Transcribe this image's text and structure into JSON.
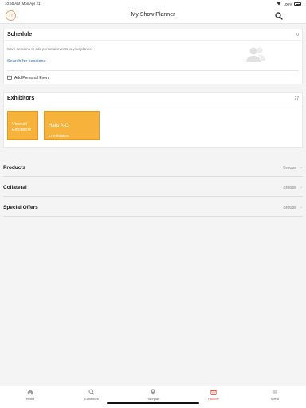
{
  "status": {
    "time": "10:50 AM",
    "date": "Mon Apr 21",
    "battery": "100%"
  },
  "header": {
    "avatar_initials": "TT",
    "title": "My Show Planner",
    "search_icon": "search-icon"
  },
  "schedule": {
    "title": "Schedule",
    "count": "0",
    "description": "Save sessions or add personal events to your planner",
    "search_link": "Search for sessions",
    "add_event": "Add Personal Event"
  },
  "exhibitors": {
    "title": "Exhibitors",
    "count": "27",
    "view_all": "View all Exhibitors",
    "halls_title": "Halls A-C",
    "halls_count": "27 exhibitors"
  },
  "sections": [
    {
      "label": "Products",
      "action": "Browse"
    },
    {
      "label": "Collateral",
      "action": "Browse"
    },
    {
      "label": "Special Offers",
      "action": "Browse"
    }
  ],
  "tabs": [
    {
      "label": "Home",
      "icon": "home-icon"
    },
    {
      "label": "Exhibitors",
      "icon": "search-icon"
    },
    {
      "label": "Floorplan",
      "icon": "map-pin-icon"
    },
    {
      "label": "Planner",
      "icon": "calendar-icon",
      "active": true
    },
    {
      "label": "Menu",
      "icon": "menu-icon"
    }
  ],
  "colors": {
    "accent": "#f7b23b",
    "link": "#3a6fb5",
    "active_tab": "#e0564a",
    "avatar": "#f39c6b"
  }
}
